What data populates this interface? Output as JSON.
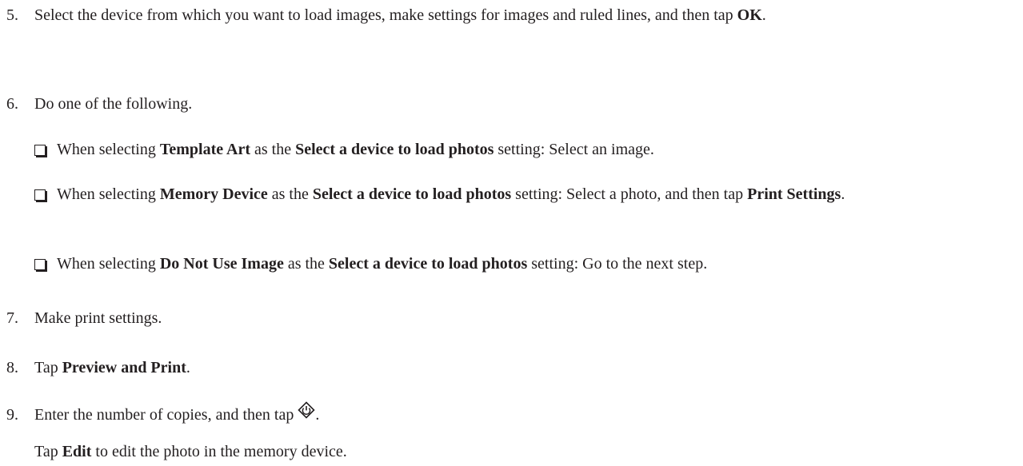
{
  "steps": [
    {
      "number": "5.",
      "parts": [
        "Select the device from which you want to load images, make settings for images and ruled lines, and then tap ",
        "OK",
        "."
      ]
    },
    {
      "number": "6.",
      "text": "Do one of the following.",
      "bullets": [
        {
          "parts": [
            "When selecting ",
            "Template Art",
            " as the ",
            "Select a device to load photos",
            " setting: Select an image."
          ]
        },
        {
          "parts": [
            "When selecting ",
            "Memory Device",
            " as the ",
            "Select a device to load photos",
            " setting: Select a photo, and then tap ",
            "Print Settings",
            "."
          ]
        },
        {
          "parts": [
            "When selecting ",
            "Do Not Use Image",
            " as the ",
            "Select a device to load photos",
            " setting: Go to the next step."
          ]
        }
      ]
    },
    {
      "number": "7.",
      "text": "Make print settings."
    },
    {
      "number": "8.",
      "parts": [
        "Tap ",
        "Preview and Print",
        "."
      ]
    },
    {
      "number": "9.",
      "parts": [
        "Enter the number of copies, and then tap ",
        "."
      ],
      "icon": "start-button-icon",
      "note_parts": [
        "Tap ",
        "Edit",
        " to edit the photo in the memory device."
      ]
    }
  ]
}
